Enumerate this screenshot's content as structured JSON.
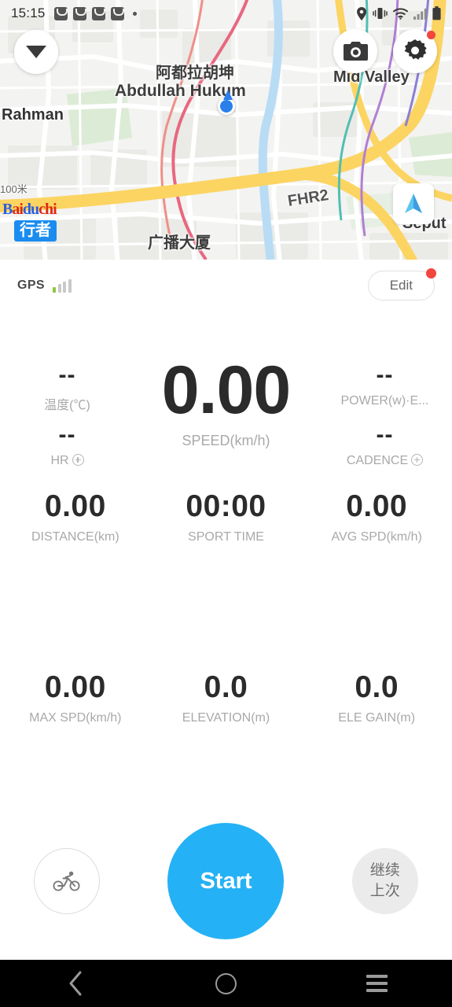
{
  "status_bar": {
    "clock": "15:15",
    "notification_icons": [
      "app-notification-icon",
      "app-notification-icon",
      "app-notification-icon",
      "app-notification-icon"
    ],
    "right_icons": [
      "location-icon",
      "vibrate-icon",
      "wifi-icon",
      "cellular-signal-icon",
      "battery-icon"
    ]
  },
  "map": {
    "labels": {
      "abdullah_hukum_cn": "阿都拉胡坤",
      "abdullah_hukum_en": "Abdullah Hukum",
      "rahman": "Rahman",
      "mid_valley": "Mid Valley",
      "highway": "FHR2",
      "guangbo_building": "广播大厦",
      "seputeh": "Seput",
      "scale": "100米"
    },
    "watermark": {
      "provider_b1": "B",
      "provider_b2": "ai",
      "provider_b3": "du",
      "provider_b4": "chi",
      "app_badge": "行者"
    },
    "buttons": {
      "collapse": "collapse-map-button",
      "camera": "camera-button",
      "settings": "settings-button",
      "locate": "locate-button"
    }
  },
  "dashboard": {
    "gps": {
      "label": "GPS",
      "bars_total": 4,
      "bars_active": 1,
      "active_color": "#8dc63f",
      "inactive_color": "#c9c9c9"
    },
    "edit_button": {
      "label": "Edit",
      "badge_color": "#f2453d"
    },
    "speed": {
      "value": "0.00",
      "label": "SPEED(km/h)"
    },
    "side_metrics": [
      {
        "value": "--",
        "label": "温度(℃)",
        "has_add": false
      },
      {
        "value": "--",
        "label": "HR",
        "has_add": true
      },
      {
        "value": "--",
        "label": "POWER(w)·E...",
        "has_add": false
      },
      {
        "value": "--",
        "label": "CADENCE",
        "has_add": true
      }
    ],
    "metric_rows": [
      [
        {
          "value": "0.00",
          "label": "DISTANCE(km)"
        },
        {
          "value": "00:00",
          "label": "SPORT TIME"
        },
        {
          "value": "0.00",
          "label": "AVG SPD(km/h)"
        }
      ],
      [
        {
          "value": "0.00",
          "label": "MAX SPD(km/h)"
        },
        {
          "value": "0.0",
          "label": "ELEVATION(m)"
        },
        {
          "value": "0.0",
          "label": "ELE GAIN(m)"
        }
      ]
    ],
    "controls": {
      "sport_type_icon": "cyclist-icon",
      "start_label": "Start",
      "start_color": "#25b1f5",
      "resume_line1": "继续",
      "resume_line2": "上次"
    }
  },
  "navbar": {
    "back": "back-icon",
    "home": "home-icon",
    "recents": "recents-icon"
  }
}
